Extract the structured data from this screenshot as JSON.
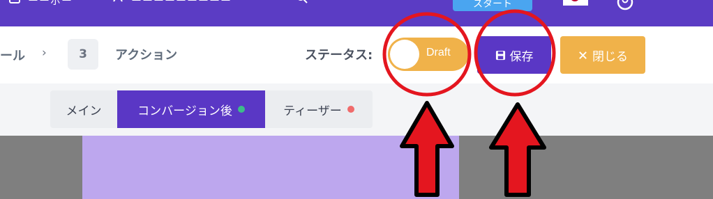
{
  "topnav": {
    "start_label": "スタート"
  },
  "header": {
    "prev_crumb": "ール",
    "separator": "›",
    "step_number": "3",
    "step_label": "アクション",
    "status_label": "ステータス:",
    "status_toggle_text": "Draft",
    "save_label": "保存",
    "close_label": "閉じる"
  },
  "tabs": [
    {
      "label": "メイン"
    },
    {
      "label": "コンバージョン後",
      "dot_color": "#3dbb8a"
    },
    {
      "label": "ティーザー",
      "dot_color": "#f06b6b"
    }
  ],
  "colors": {
    "nav_bg": "#5b3cc4",
    "accent_purple": "#5a37c5",
    "accent_orange": "#f0b24a",
    "annotation_red": "#e4161f",
    "preview_purple": "#bda7ee"
  }
}
